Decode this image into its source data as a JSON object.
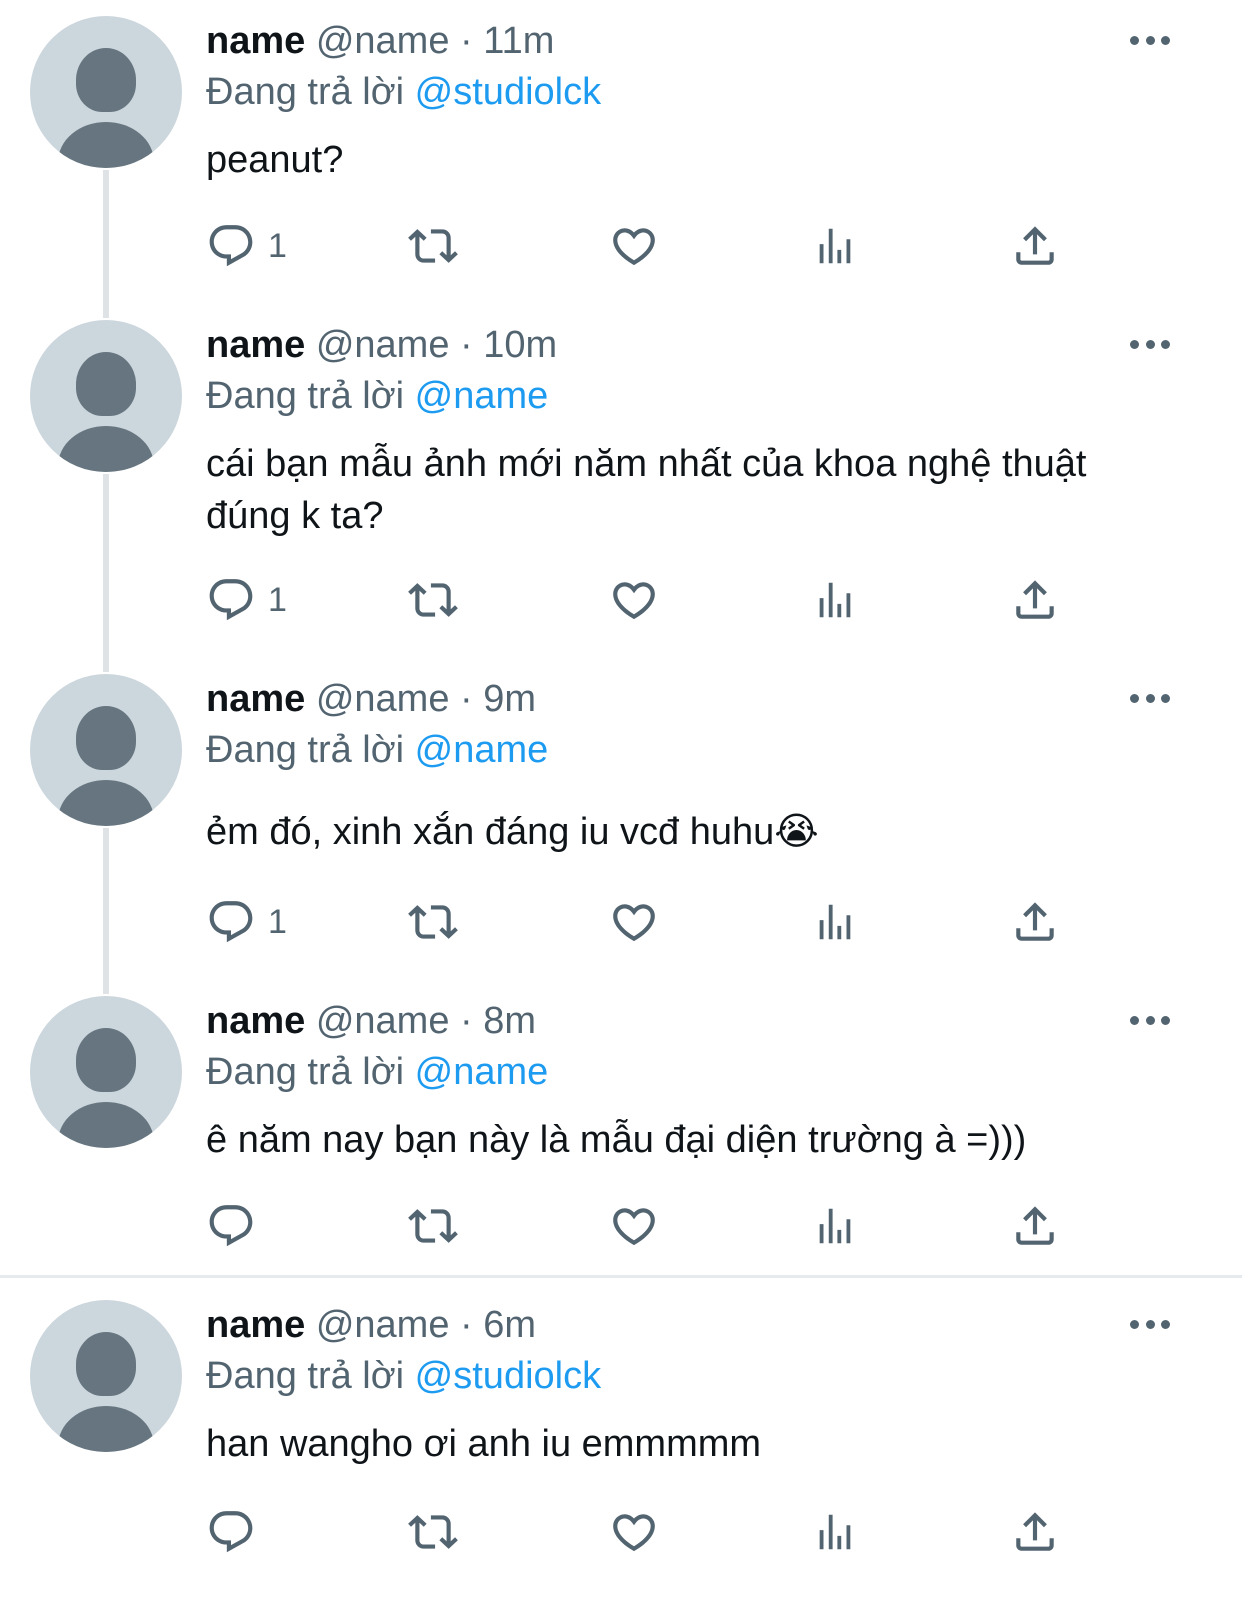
{
  "tweets": [
    {
      "display_name": "name",
      "handle": "@name",
      "separator": "·",
      "time": "11m",
      "replying_prefix": "Đang trả lời",
      "replying_to": "@studiolck",
      "text": "peanut?",
      "reply_count": "1"
    },
    {
      "display_name": "name",
      "handle": "@name",
      "separator": "·",
      "time": "10m",
      "replying_prefix": "Đang trả lời",
      "replying_to": "@name",
      "text": "cái bạn mẫu ảnh mới năm nhất của khoa nghệ thuật đúng k ta?",
      "reply_count": "1"
    },
    {
      "display_name": "name",
      "handle": "@name",
      "separator": "·",
      "time": "9m",
      "replying_prefix": "Đang trả lời",
      "replying_to": "@name",
      "text": "ẻm đó, xinh xắn đáng iu vcđ huhu😭",
      "reply_count": "1"
    },
    {
      "display_name": "name",
      "handle": "@name",
      "separator": "·",
      "time": "8m",
      "replying_prefix": "Đang trả lời",
      "replying_to": "@name",
      "text": "ê năm nay bạn này là mẫu đại diện trường à =)))",
      "reply_count": ""
    },
    {
      "display_name": "name",
      "handle": "@name",
      "separator": "·",
      "time": "6m",
      "replying_prefix": "Đang trả lời",
      "replying_to": "@studiolck",
      "text": "han wangho ơi anh iu emmmmm",
      "reply_count": ""
    }
  ],
  "icons": {
    "reply": "reply-icon",
    "retweet": "retweet-icon",
    "like": "like-icon",
    "views": "views-icon",
    "share": "share-icon",
    "more": "more-icon"
  },
  "colors": {
    "text": "#0f1419",
    "secondary": "#536471",
    "accent": "#1d9bf0",
    "avatar_bg": "#ccd6dd",
    "avatar_fg": "#66757f",
    "thread_line": "#dfe3e6"
  }
}
